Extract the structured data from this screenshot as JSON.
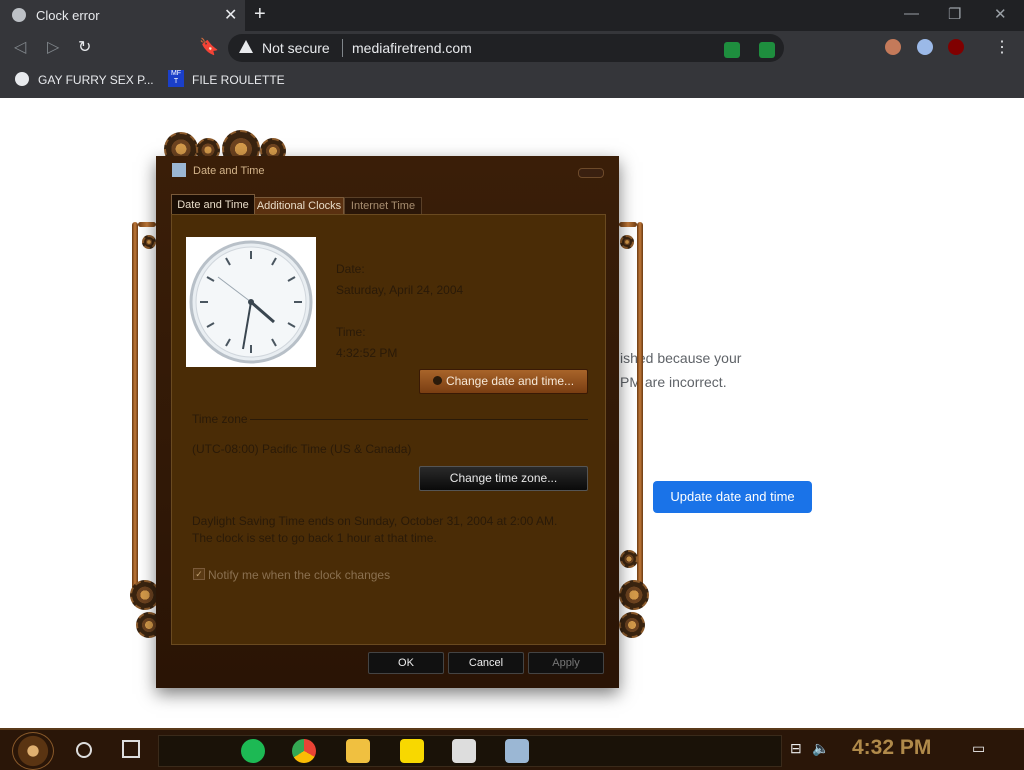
{
  "browser": {
    "tab_title": "Clock error",
    "security_label": "Not secure",
    "url": "mediafiretrend.com",
    "bookmarks": [
      "GAY FURRY SEX P...",
      "FILE ROULETTE"
    ],
    "bookmark_icon_text": "MF T"
  },
  "page": {
    "error_line1": "ished because your",
    "error_line2": "PM are incorrect.",
    "update_button": "Update date and time"
  },
  "dialog": {
    "title": "Date and Time",
    "tabs": [
      "Date and Time",
      "Additional Clocks",
      "Internet Time"
    ],
    "date_label": "Date:",
    "date_value": "Saturday, April 24, 2004",
    "time_label": "Time:",
    "time_value": "4:32:52 PM",
    "change_datetime_button": "Change date and time...",
    "timezone_heading": "Time zone",
    "timezone_value": "(UTC-08:00) Pacific Time (US & Canada)",
    "change_timezone_button": "Change time zone...",
    "dst_line1": "Daylight Saving Time ends on Sunday, October 31, 2004 at 2:00 AM.",
    "dst_line2": "The clock is set to go back 1 hour at that time.",
    "notify_label": "Notify me when the clock changes",
    "notify_checked": true,
    "ok": "OK",
    "cancel": "Cancel",
    "apply": "Apply"
  },
  "taskbar": {
    "time": "4:32 PM",
    "accent_color": "#b08a4a"
  }
}
